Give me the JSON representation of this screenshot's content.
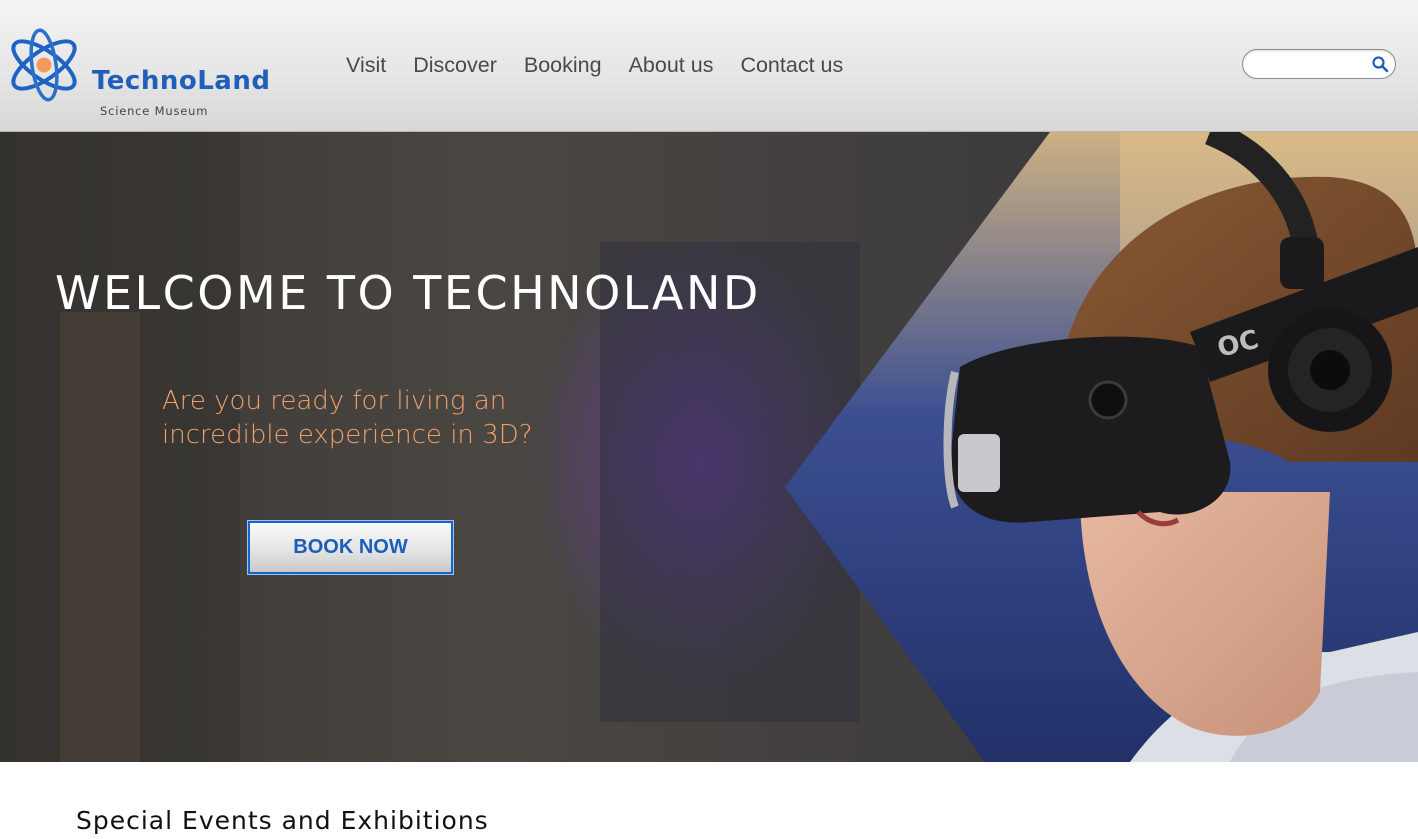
{
  "brand": {
    "title_part1": "Techno",
    "title_part2": "Land",
    "subtitle": "Science Museum"
  },
  "nav": {
    "items": [
      {
        "label": "Visit"
      },
      {
        "label": "Discover"
      },
      {
        "label": "Booking"
      },
      {
        "label": "About us"
      },
      {
        "label": "Contact us"
      }
    ]
  },
  "search": {
    "value": "",
    "icon": "search-icon"
  },
  "hero": {
    "title": "WELCOME TO TECHNOLAND",
    "subtitle": "Are you ready for living an incredible experience in 3D?",
    "button_label": "BOOK NOW",
    "image": "boy-wearing-vr-headset-photo"
  },
  "section": {
    "title": "Special Events and Exhibitions"
  },
  "colors": {
    "accent_blue": "#1f5fb9",
    "accent_orange": "#f29a5a",
    "hero_subtitle": "#f0a06b"
  }
}
